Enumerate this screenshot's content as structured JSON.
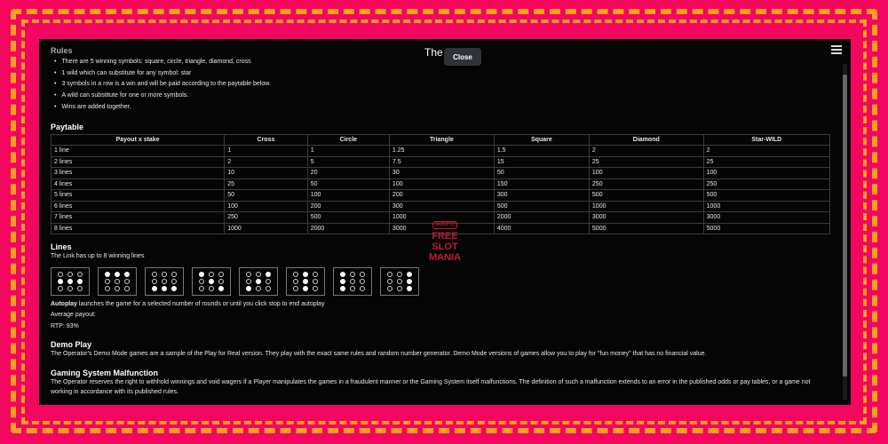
{
  "window": {
    "title": "The Link",
    "close_label": "Close"
  },
  "rules": {
    "heading": "Rules",
    "items": [
      "There are 5 winning symbols: square, circle, triangle, diamond, cross",
      "1 wild which can substitute for any symbol: star",
      "3 symbols in a row is a win and will be paid according to the paytable below.",
      "A wild can substitute for one or more symbols.",
      "Wins are added together."
    ]
  },
  "paytable": {
    "heading": "Paytable",
    "columns": [
      "Payout x stake",
      "Cross",
      "Circle",
      "Triangle",
      "Square",
      "Diamond",
      "Star-WILD"
    ],
    "rows": [
      [
        "1 line",
        "1",
        "1",
        "1.25",
        "1.5",
        "2",
        "2"
      ],
      [
        "2 lines",
        "2",
        "5",
        "7.5",
        "15",
        "25",
        "25"
      ],
      [
        "3 lines",
        "10",
        "20",
        "30",
        "50",
        "100",
        "100"
      ],
      [
        "4 lines",
        "25",
        "50",
        "100",
        "150",
        "250",
        "250"
      ],
      [
        "5 lines",
        "50",
        "100",
        "200",
        "300",
        "500",
        "500"
      ],
      [
        "6 lines",
        "100",
        "200",
        "300",
        "500",
        "1000",
        "1000"
      ],
      [
        "7 lines",
        "250",
        "500",
        "1000",
        "2000",
        "3000",
        "3000"
      ],
      [
        "8 lines",
        "1000",
        "2000",
        "3000",
        "4000",
        "5000",
        "5000"
      ]
    ]
  },
  "lines": {
    "heading": "Lines",
    "description": "The Link has up to 8 winning lines",
    "patterns": [
      [
        0,
        0,
        0,
        1,
        1,
        1,
        0,
        0,
        0
      ],
      [
        1,
        1,
        1,
        0,
        0,
        0,
        0,
        0,
        0
      ],
      [
        0,
        0,
        0,
        0,
        0,
        0,
        1,
        1,
        1
      ],
      [
        1,
        0,
        0,
        0,
        1,
        0,
        0,
        0,
        1
      ],
      [
        0,
        0,
        1,
        0,
        1,
        0,
        1,
        0,
        0
      ],
      [
        0,
        1,
        0,
        0,
        1,
        0,
        0,
        1,
        0
      ],
      [
        1,
        0,
        0,
        1,
        0,
        0,
        1,
        0,
        0
      ],
      [
        0,
        0,
        1,
        0,
        0,
        1,
        0,
        0,
        1
      ]
    ]
  },
  "autoplay": {
    "label": "Autoplay",
    "text": " launches the game for a selected number of rounds or until you click stop to end autoplay",
    "average_payout": "Average payout:",
    "rtp": "RTP: 93%"
  },
  "demo": {
    "heading": "Demo Play",
    "text": "The Operator's Demo Mode games are a sample of the Play for Real version. They play with the exact same rules and random number generator. Demo Mode versions of games allow you to play for \"fun money\" that has no financial value."
  },
  "malfunction": {
    "heading": "Gaming System Malfunction",
    "text": "The Operator reserves the right to withhold winnings and void wagers if a Player manipulates the games in a fraudulent manner or the Gaming System itself malfunctions. The definition of such a malfunction extends to an error in the published odds or pay tables, or a game not working in accordance with its published rules."
  },
  "watermark": {
    "top": "JACKPOT",
    "lines": [
      "FREE",
      "SLOT",
      "MANIA"
    ]
  },
  "colors": {
    "background": "#f2065f",
    "frame_dash": "#f7a21b",
    "panel": "#050505",
    "watermark": "#d41f36"
  }
}
